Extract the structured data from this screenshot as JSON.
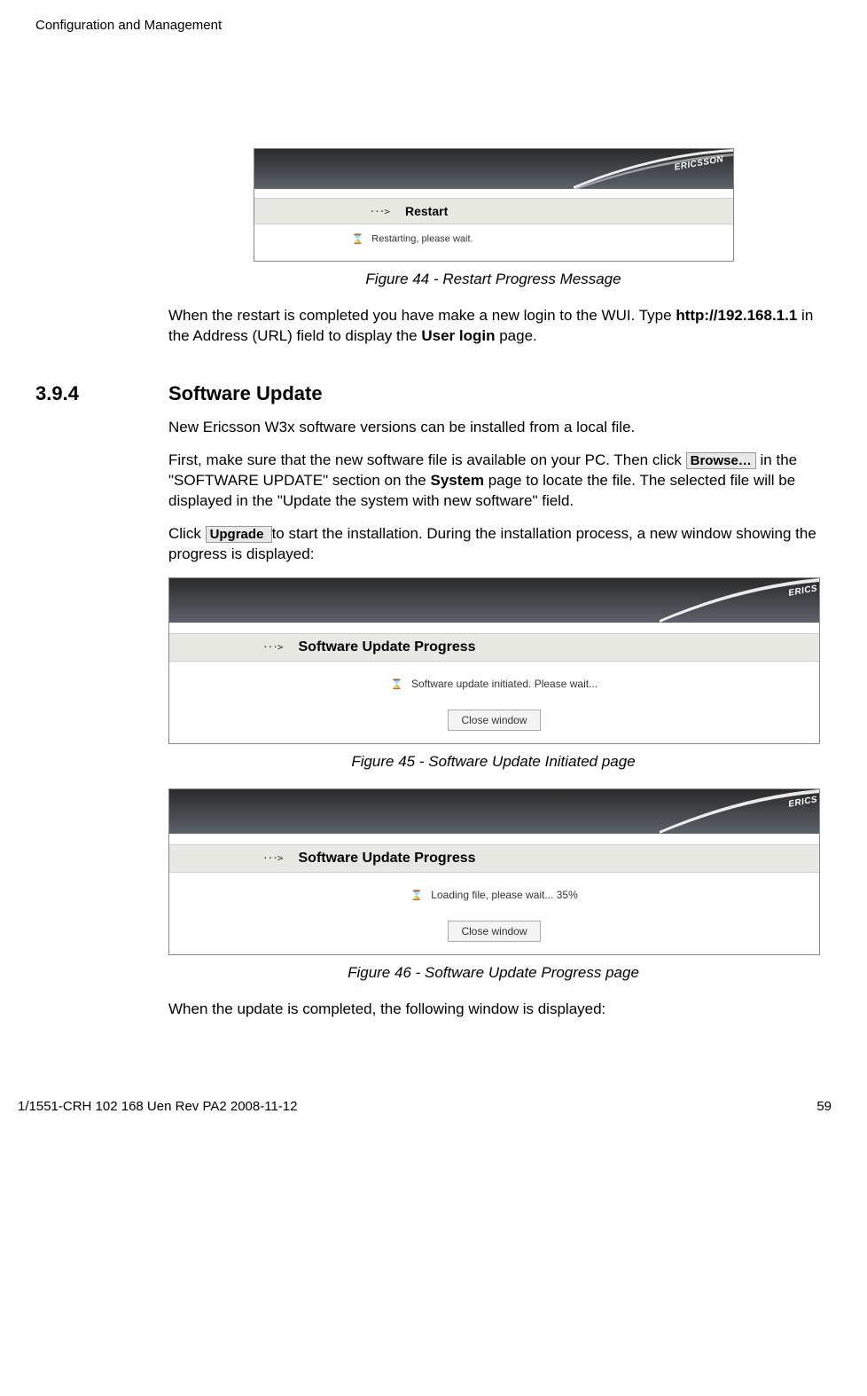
{
  "header": "Configuration and Management",
  "fig44": {
    "brand": "ERICSSON",
    "arrow": "···>",
    "barTitle": "Restart",
    "status": "Restarting, please wait.",
    "caption": "Figure 44 - Restart Progress Message"
  },
  "p1a": "When the restart is completed you have make a new login to the WUI. Type ",
  "p1b": "http://192.168.1.1",
  "p1c": " in the Address (URL) field to display the ",
  "p1d": "User login",
  "p1e": " page.",
  "section": {
    "num": "3.9.4",
    "title": "Software Update"
  },
  "p2": "New Ericsson W3x software versions can be installed from a local file.",
  "p3a": "First, make sure that the new software file is available on your PC. Then click ",
  "btnBrowse": " Browse…",
  "p3b": " in the \"SOFTWARE UPDATE\" section on the ",
  "p3c": "System",
  "p3d": " page to locate the file. The selected file will be displayed in the \"Update the system with new software\" field.",
  "p4a": "Click ",
  "btnUpgrade": " Upgrade ",
  "p4b": " to start the installation. During the installation process, a new window showing the progress is displayed:",
  "fig45": {
    "brand": "ERICS",
    "arrow": "···>",
    "barTitle": "Software Update Progress",
    "status": "Software update initiated. Please wait...",
    "closeBtn": "Close window",
    "caption": "Figure 45 - Software Update Initiated page"
  },
  "fig46": {
    "brand": "ERICS",
    "arrow": "···>",
    "barTitle": "Software Update Progress",
    "status": "Loading file, please wait... 35%",
    "closeBtn": "Close window",
    "caption": "Figure 46 - Software Update Progress page"
  },
  "p5": "When the update is completed, the following window is displayed:",
  "footer": {
    "left": "1/1551-CRH 102 168 Uen Rev PA2  2008-11-12",
    "right": "59"
  }
}
